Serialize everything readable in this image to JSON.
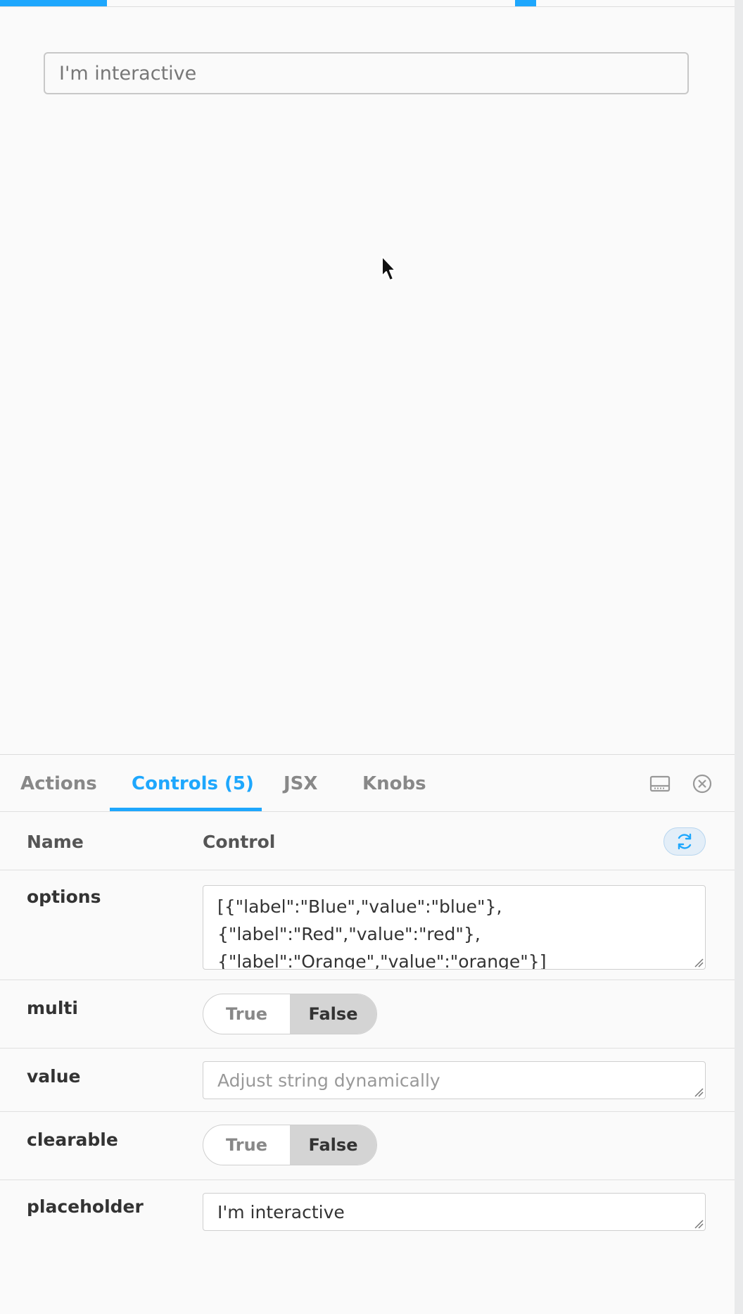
{
  "preview": {
    "select_placeholder": "I'm interactive"
  },
  "tabs": [
    {
      "label": "Actions",
      "active": false
    },
    {
      "label": "Controls (5)",
      "active": true
    },
    {
      "label": "JSX",
      "active": false
    },
    {
      "label": "Knobs",
      "active": false
    }
  ],
  "toolbar_icons": [
    "panel-bottom-icon",
    "close-icon"
  ],
  "table": {
    "col_name": "Name",
    "col_control": "Control",
    "reset_icon": "refresh-icon"
  },
  "rows": {
    "options": {
      "name": "options",
      "value_lines": [
        "[{\"label\":\"Blue\",\"value\":\"blue\"},",
        "{\"label\":\"Red\",\"value\":\"red\"},",
        "{\"label\":\"Orange\",\"value\":\"orange\"}]"
      ]
    },
    "multi": {
      "name": "multi",
      "true_label": "True",
      "false_label": "False",
      "selected": "False"
    },
    "value": {
      "name": "value",
      "placeholder": "Adjust string dynamically"
    },
    "clearable": {
      "name": "clearable",
      "true_label": "True",
      "false_label": "False",
      "selected": "False"
    },
    "placeholder": {
      "name": "placeholder",
      "value": "I'm interactive"
    }
  },
  "colors": {
    "accent": "#1ea7fd",
    "toggle_selected": "#d4d4d4",
    "background": "#fafafa"
  }
}
